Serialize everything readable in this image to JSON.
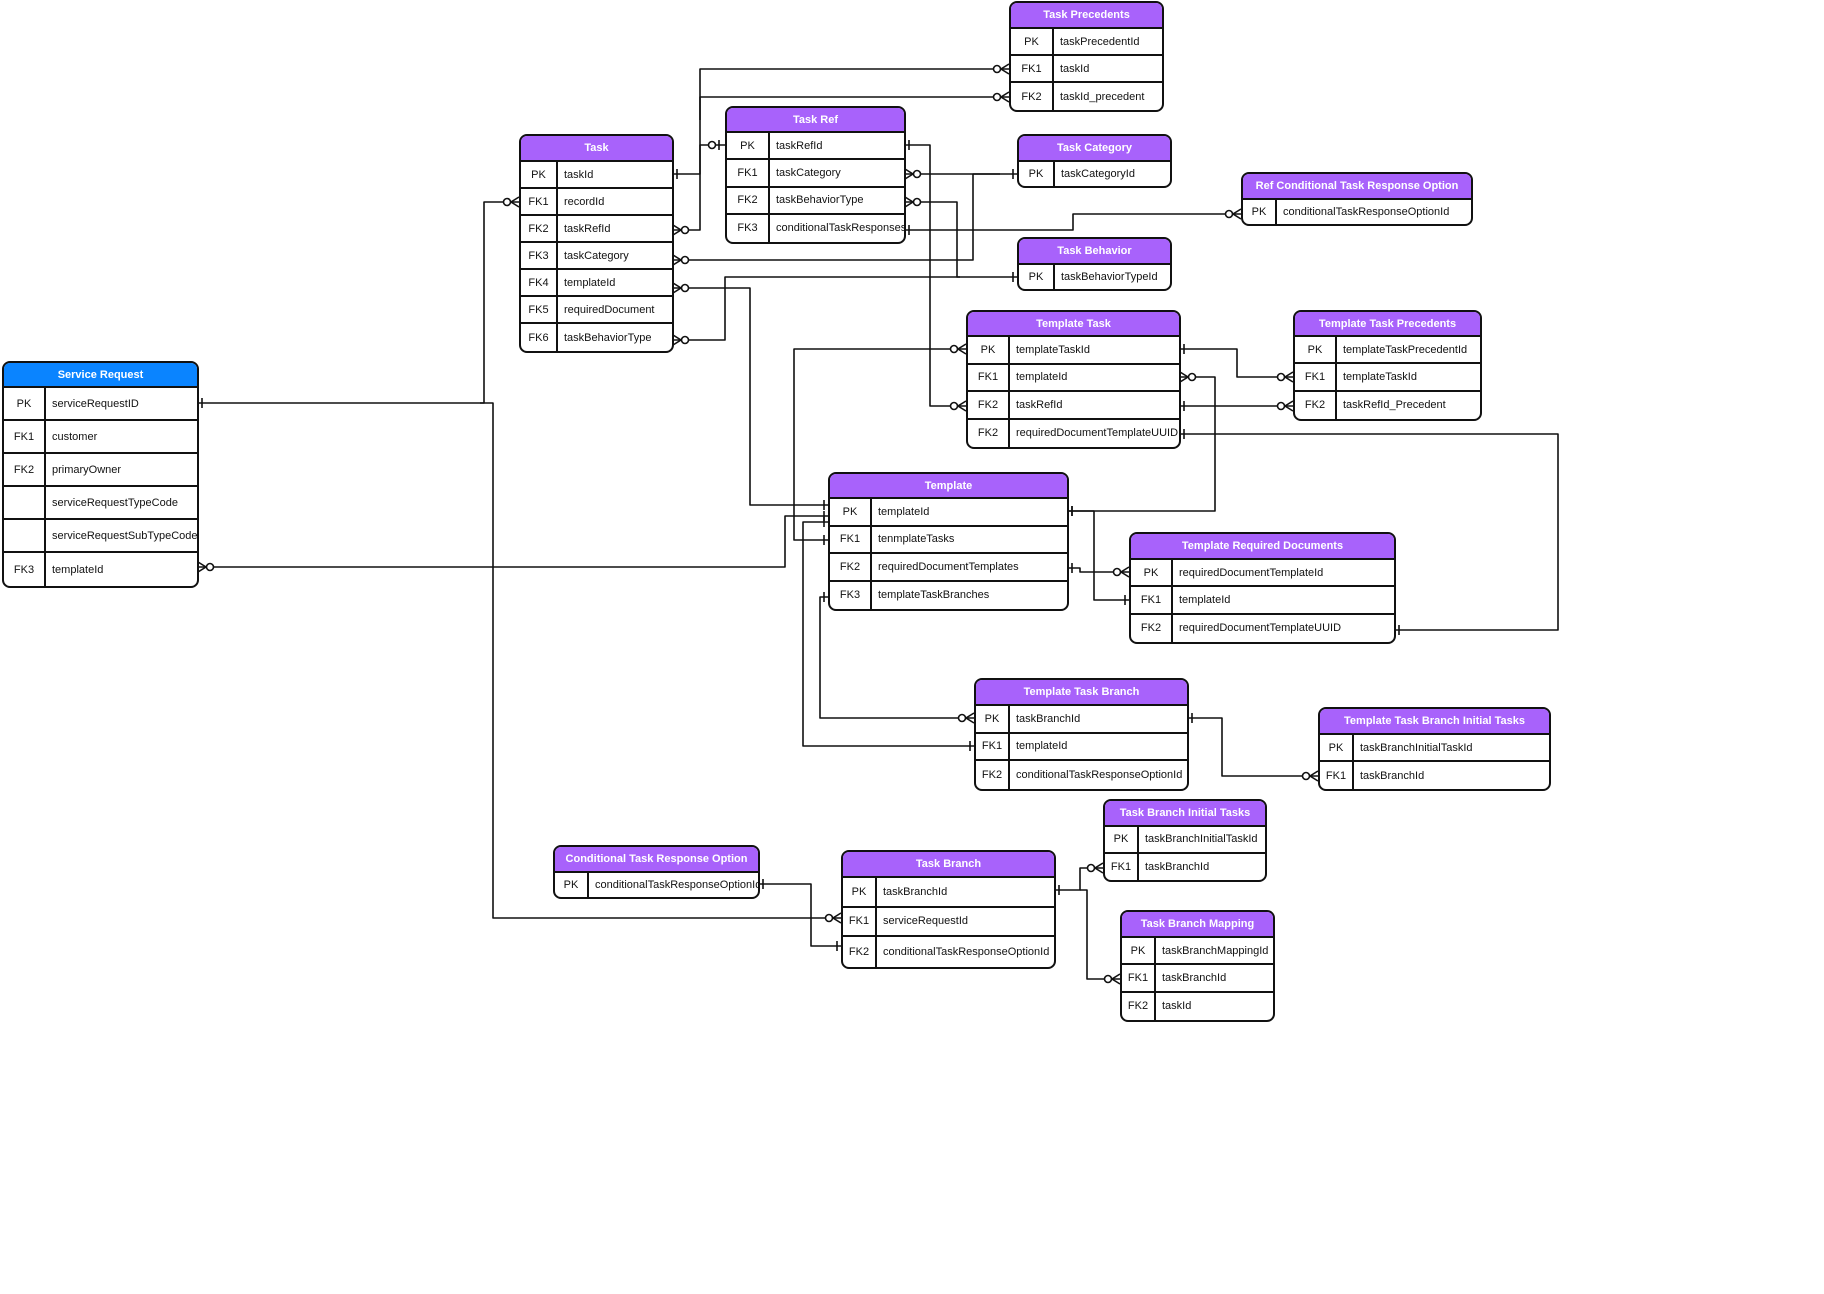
{
  "colors": {
    "entity_header": "#a862fb",
    "primary_entity_header": "#0a84ff",
    "line": "#111111"
  },
  "tables": {
    "service_request": {
      "title": "Service Request",
      "rows": [
        [
          "PK",
          "serviceRequestID"
        ],
        [
          "FK1",
          "customer"
        ],
        [
          "FK2",
          "primaryOwner"
        ],
        [
          "",
          "serviceRequestTypeCode"
        ],
        [
          "",
          "serviceRequestSubTypeCode"
        ],
        [
          "FK3",
          "templateId"
        ]
      ]
    },
    "task": {
      "title": "Task",
      "rows": [
        [
          "PK",
          "taskId"
        ],
        [
          "FK1",
          "recordId"
        ],
        [
          "FK2",
          "taskRefId"
        ],
        [
          "FK3",
          "taskCategory"
        ],
        [
          "FK4",
          "templateId"
        ],
        [
          "FK5",
          "requiredDocument"
        ],
        [
          "FK6",
          "taskBehaviorType"
        ]
      ]
    },
    "task_ref": {
      "title": "Task Ref",
      "rows": [
        [
          "PK",
          "taskRefId"
        ],
        [
          "FK1",
          "taskCategory"
        ],
        [
          "FK2",
          "taskBehaviorType"
        ],
        [
          "FK3",
          "conditionalTaskResponses"
        ]
      ]
    },
    "task_precedents": {
      "title": "Task Precedents",
      "rows": [
        [
          "PK",
          "taskPrecedentId"
        ],
        [
          "FK1",
          "taskId"
        ],
        [
          "FK2",
          "taskId_precedent"
        ]
      ]
    },
    "task_category": {
      "title": "Task Category",
      "rows": [
        [
          "PK",
          "taskCategoryId"
        ]
      ]
    },
    "ref_conditional": {
      "title": "Ref Conditional Task Response Option",
      "rows": [
        [
          "PK",
          "conditionalTaskResponseOptionId"
        ]
      ]
    },
    "task_behavior": {
      "title": "Task Behavior",
      "rows": [
        [
          "PK",
          "taskBehaviorTypeId"
        ]
      ]
    },
    "template_task": {
      "title": "Template Task",
      "rows": [
        [
          "PK",
          "templateTaskId"
        ],
        [
          "FK1",
          "templateId"
        ],
        [
          "FK2",
          "taskRefId"
        ],
        [
          "FK2",
          "requiredDocumentTemplateUUID"
        ]
      ]
    },
    "template_task_precedents": {
      "title": "Template Task Precedents",
      "rows": [
        [
          "PK",
          "templateTaskPrecedentId"
        ],
        [
          "FK1",
          "templateTaskId"
        ],
        [
          "FK2",
          "taskRefId_Precedent"
        ]
      ]
    },
    "template": {
      "title": "Template",
      "rows": [
        [
          "PK",
          "templateId"
        ],
        [
          "FK1",
          "tenmplateTasks"
        ],
        [
          "FK2",
          "requiredDocumentTemplates"
        ],
        [
          "FK3",
          "templateTaskBranches"
        ]
      ]
    },
    "template_required_documents": {
      "title": "Template Required Documents",
      "rows": [
        [
          "PK",
          "requiredDocumentTemplateId"
        ],
        [
          "FK1",
          "templateId"
        ],
        [
          "FK2",
          "requiredDocumentTemplateUUID"
        ]
      ]
    },
    "template_task_branch": {
      "title": "Template Task Branch",
      "rows": [
        [
          "PK",
          "taskBranchId"
        ],
        [
          "FK1",
          "templateId"
        ],
        [
          "FK2",
          "conditionalTaskResponseOptionId"
        ]
      ]
    },
    "template_task_branch_initial": {
      "title": "Template Task Branch Initial Tasks",
      "rows": [
        [
          "PK",
          "taskBranchInitialTaskId"
        ],
        [
          "FK1",
          "taskBranchId"
        ]
      ]
    },
    "task_branch_initial": {
      "title": "Task Branch Initial Tasks",
      "rows": [
        [
          "PK",
          "taskBranchInitialTaskId"
        ],
        [
          "FK1",
          "taskBranchId"
        ]
      ]
    },
    "conditional_option": {
      "title": "Conditional Task Response Option",
      "rows": [
        [
          "PK",
          "conditionalTaskResponseOptionId"
        ]
      ]
    },
    "task_branch": {
      "title": "Task Branch",
      "rows": [
        [
          "PK",
          "taskBranchId"
        ],
        [
          "FK1",
          "serviceRequestId"
        ],
        [
          "FK2",
          "conditionalTaskResponseOptionId"
        ]
      ]
    },
    "task_branch_mapping": {
      "title": "Task Branch Mapping",
      "rows": [
        [
          "PK",
          "taskBranchMappingId"
        ],
        [
          "FK1",
          "taskBranchId"
        ],
        [
          "FK2",
          "taskId"
        ]
      ]
    }
  }
}
